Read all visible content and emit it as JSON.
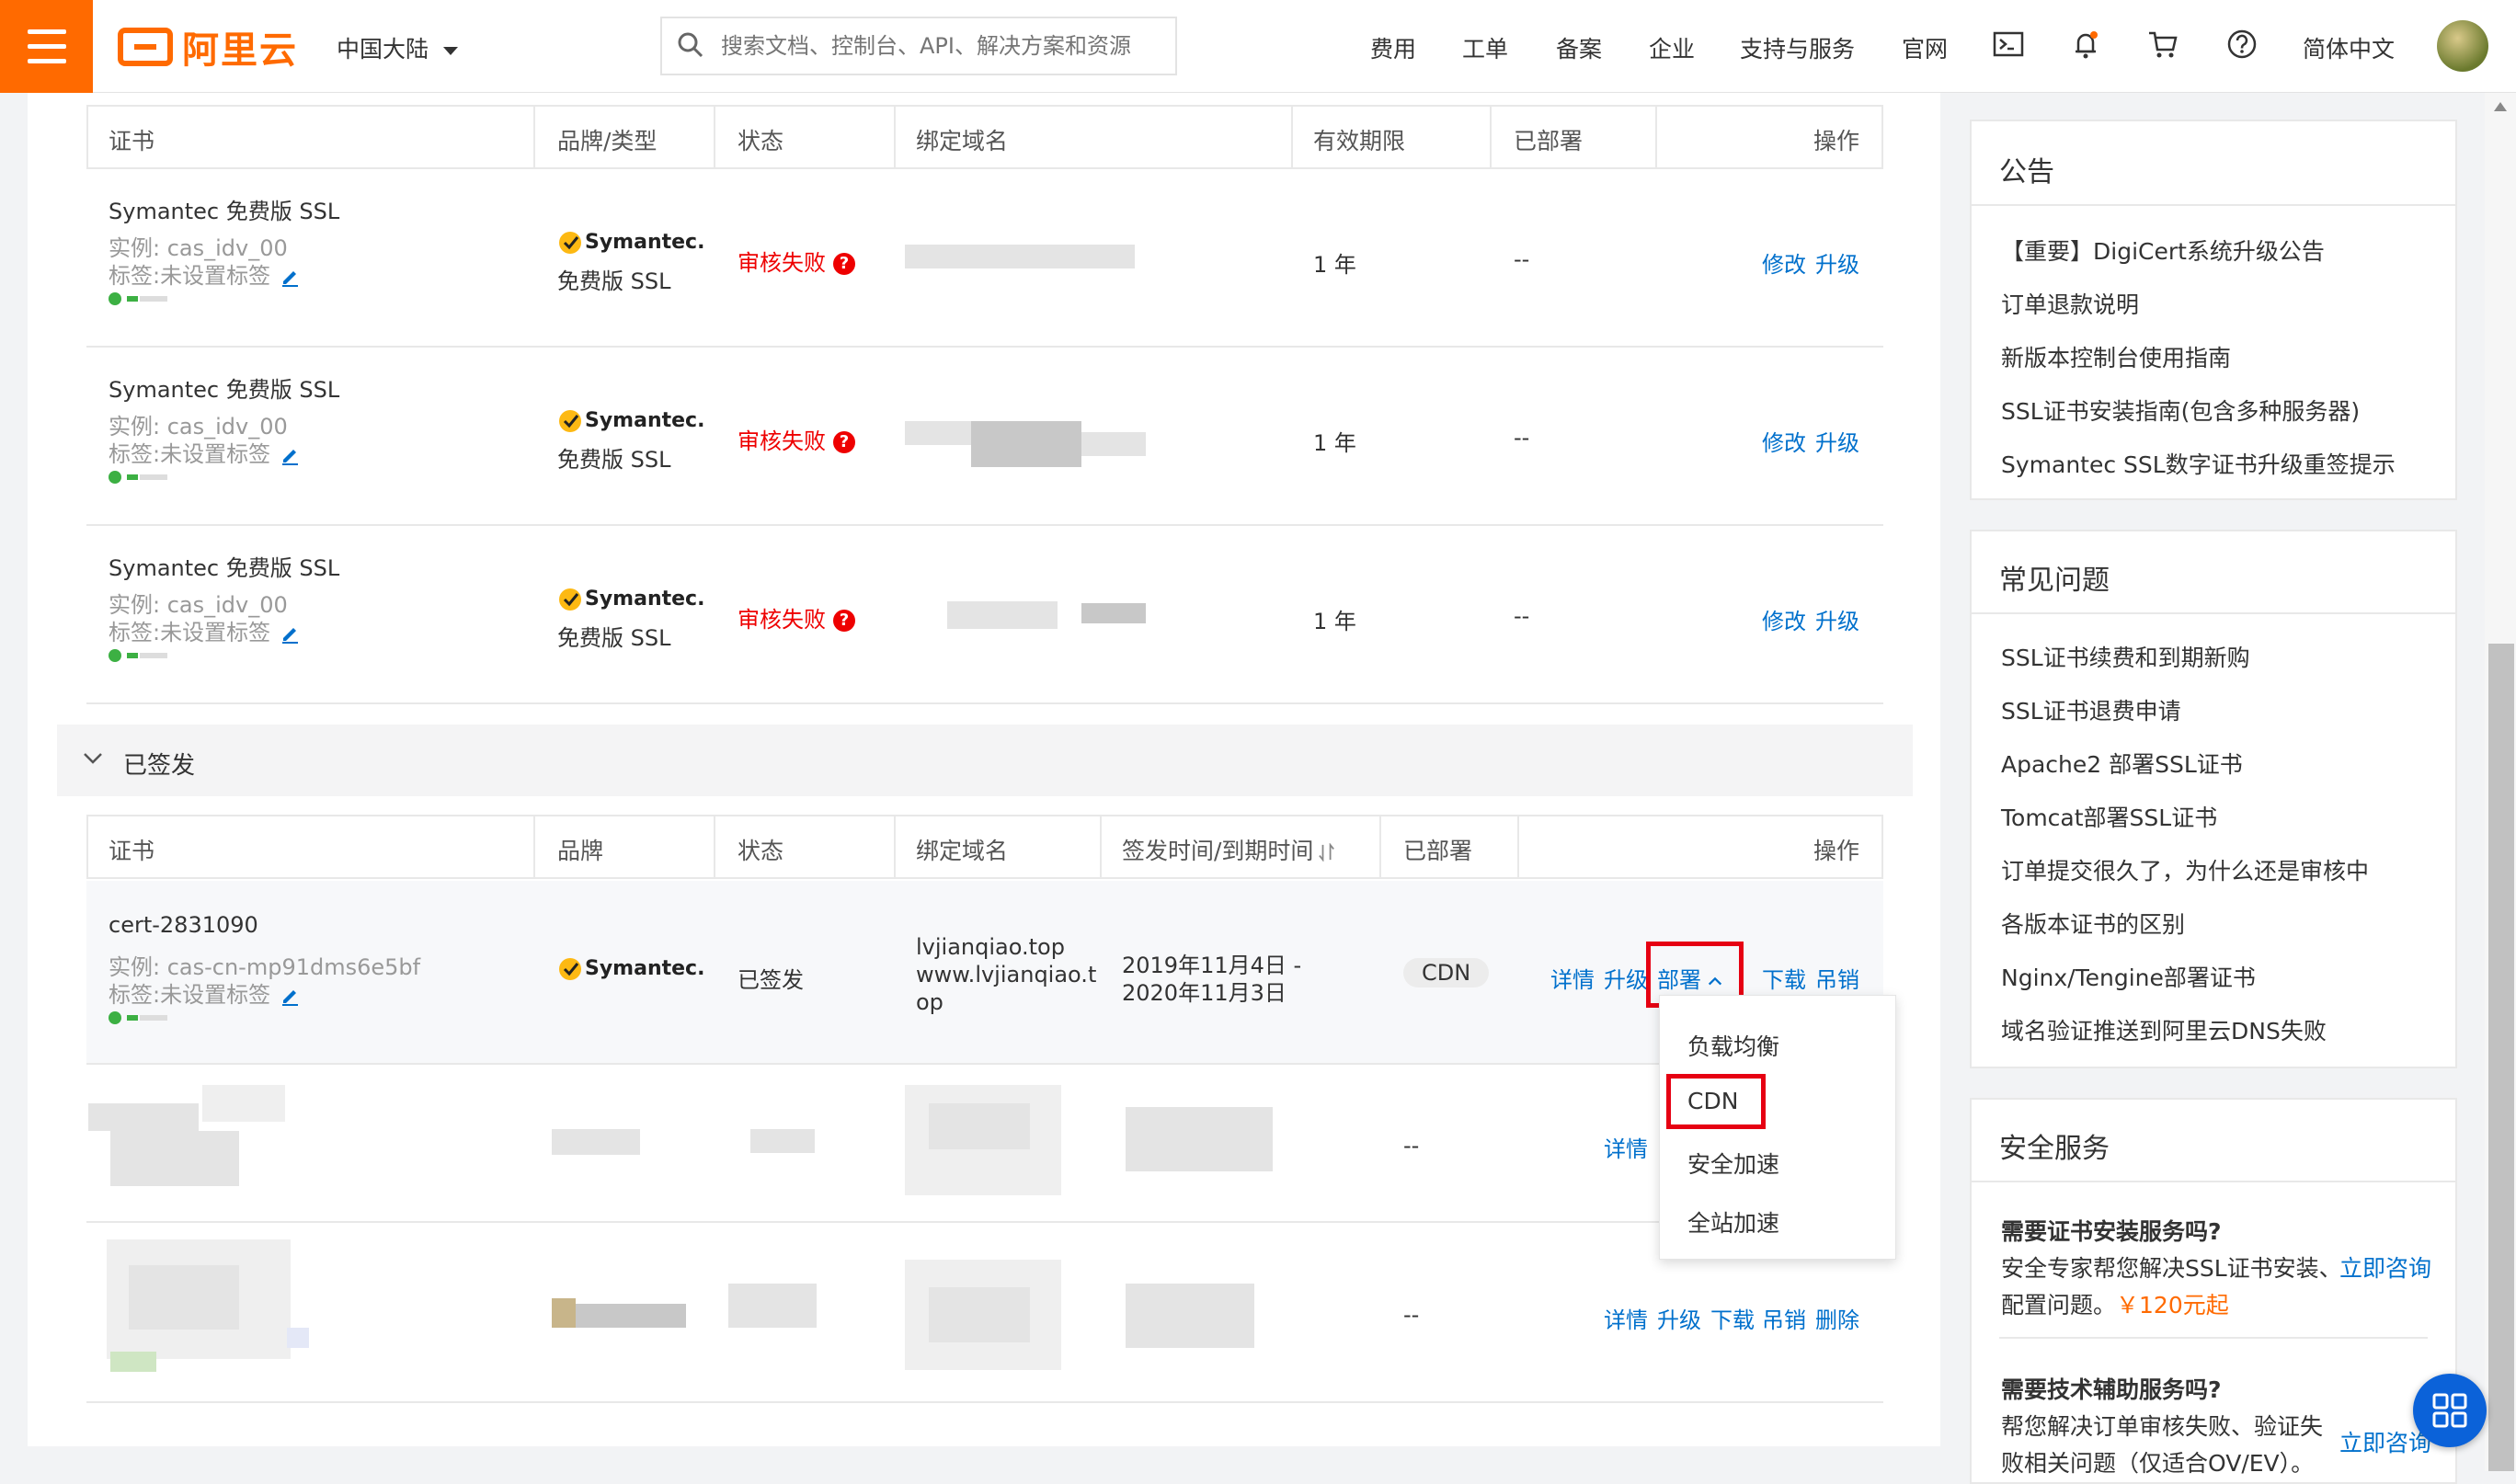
{
  "topbar": {
    "logo_text": "阿里云",
    "region": "中国大陆",
    "search_placeholder": "搜索文档、控制台、API、解决方案和资源",
    "nav": [
      "费用",
      "工单",
      "备案",
      "企业",
      "支持与服务",
      "官网"
    ],
    "language": "简体中文"
  },
  "pending_table": {
    "headers": {
      "cert": "证书",
      "brand": "品牌/类型",
      "status": "状态",
      "domain": "绑定域名",
      "validity": "有效期限",
      "deployed": "已部署",
      "action": "操作"
    },
    "rows": [
      {
        "name": "Symantec 免费版 SSL",
        "instance": "实例: cas_idv_00",
        "tag": "标签:未设置标签",
        "brand": "Symantec.",
        "brand_type": "免费版 SSL",
        "status": "审核失败",
        "validity": "1 年",
        "deployed": "--",
        "action_modify": "修改",
        "action_upgrade": "升级"
      },
      {
        "name": "Symantec 免费版 SSL",
        "instance": "实例: cas_idv_00",
        "tag": "标签:未设置标签",
        "brand": "Symantec.",
        "brand_type": "免费版 SSL",
        "status": "审核失败",
        "validity": "1 年",
        "deployed": "--",
        "action_modify": "修改",
        "action_upgrade": "升级"
      },
      {
        "name": "Symantec 免费版 SSL",
        "instance": "实例: cas_idv_00",
        "tag": "标签:未设置标签",
        "brand": "Symantec.",
        "brand_type": "免费版 SSL",
        "status": "审核失败",
        "validity": "1 年",
        "deployed": "--",
        "action_modify": "修改",
        "action_upgrade": "升级"
      }
    ]
  },
  "issued_section": {
    "title": "已签发",
    "headers": {
      "cert": "证书",
      "brand": "品牌",
      "status": "状态",
      "domain": "绑定域名",
      "time": "签发时间/到期时间",
      "deployed": "已部署",
      "action": "操作"
    },
    "row1": {
      "name": "cert-2831090",
      "instance": "实例: cas-cn-mp91dms6e5bf",
      "tag": "标签:未设置标签",
      "brand": "Symantec.",
      "status": "已签发",
      "domain_line1": "lvjianqiao.top",
      "domain_line2": "www.lvjianqiao.t",
      "domain_line3": "op",
      "time_line1": "2019年11月4日 -",
      "time_line2": "2020年11月3日",
      "deployed": "CDN",
      "actions": {
        "detail": "详情",
        "upgrade": "升级",
        "deploy": "部署",
        "download": "下载",
        "revoke": "吊销"
      }
    },
    "row2": {
      "deployed": "--",
      "detail": "详情"
    },
    "row3": {
      "deployed": "--",
      "actions": {
        "detail": "详情",
        "upgrade": "升级",
        "download": "下载",
        "revoke": "吊销",
        "delete": "删除"
      }
    },
    "deploy_dropdown": [
      "负载均衡",
      "CDN",
      "安全加速",
      "全站加速"
    ]
  },
  "sidebar": {
    "announcement": {
      "title": "公告",
      "items": [
        "【重要】DigiCert系统升级公告",
        "订单退款说明",
        "新版本控制台使用指南",
        "SSL证书安装指南(包含多种服务器)",
        "Symantec SSL数字证书升级重签提示"
      ]
    },
    "faq": {
      "title": "常见问题",
      "items": [
        "SSL证书续费和到期新购",
        "SSL证书退费申请",
        "Apache2 部署SSL证书",
        "Tomcat部署SSL证书",
        "订单提交很久了，为什么还是审核中",
        "各版本证书的区别",
        "Nginx/Tengine部署证书",
        "域名验证推送到阿里云DNS失败"
      ]
    },
    "security": {
      "title": "安全服务",
      "service1": {
        "title": "需要证书安装服务吗?",
        "desc_line1": "安全专家帮您解决SSL证书安装、",
        "desc_line2_prefix": "配置问题。",
        "price": "￥120",
        "price_suffix": "元起",
        "cta": "立即咨询"
      },
      "service2": {
        "title": "需要技术辅助服务吗?",
        "desc_line1": "帮您解决订单审核失败、验证失",
        "desc_line2": "败相关问题（仅适合OV/EV）。",
        "cta": "立即咨询"
      }
    }
  },
  "colors": {
    "brand": "#ff6a00",
    "link": "#0070cc",
    "error": "#ee0000",
    "highlight_box": "#e60012"
  }
}
